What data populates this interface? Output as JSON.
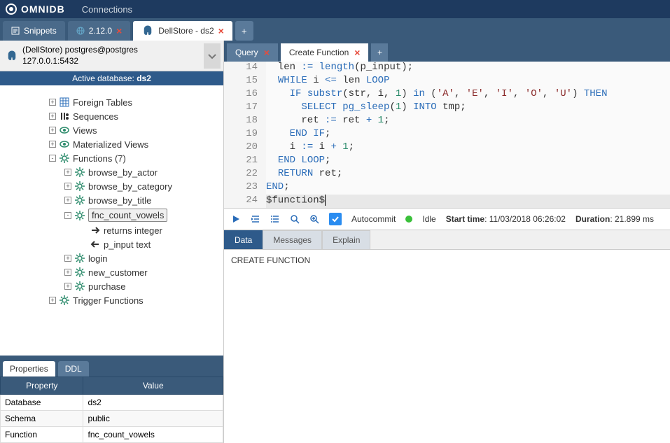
{
  "app": {
    "name": "OMNIDB",
    "connections_label": "Connections"
  },
  "tabs": [
    {
      "label": "Snippets",
      "closable": false
    },
    {
      "label": "2.12.0",
      "closable": true
    },
    {
      "label": "DellStore - ds2",
      "closable": true,
      "active": true
    }
  ],
  "connection": {
    "title": "(DellStore) postgres@postgres",
    "host": "127.0.0.1:5432",
    "active_db_prefix": "Active database: ",
    "active_db": "ds2"
  },
  "tree": {
    "nodes": [
      {
        "indent": 3,
        "toggle": "+",
        "icon": "table",
        "label": "Foreign Tables"
      },
      {
        "indent": 3,
        "toggle": "+",
        "icon": "seq",
        "label": "Sequences"
      },
      {
        "indent": 3,
        "toggle": "+",
        "icon": "view",
        "label": "Views"
      },
      {
        "indent": 3,
        "toggle": "+",
        "icon": "view",
        "label": "Materialized Views"
      },
      {
        "indent": 3,
        "toggle": "-",
        "icon": "gear",
        "label": "Functions (7)"
      },
      {
        "indent": 4,
        "toggle": "+",
        "icon": "gear",
        "label": "browse_by_actor"
      },
      {
        "indent": 4,
        "toggle": "+",
        "icon": "gear",
        "label": "browse_by_category"
      },
      {
        "indent": 4,
        "toggle": "+",
        "icon": "gear",
        "label": "browse_by_title"
      },
      {
        "indent": 4,
        "toggle": "-",
        "icon": "gear",
        "label": "fnc_count_vowels",
        "selected": true
      },
      {
        "indent": 5,
        "toggle": "",
        "icon": "arrow-right",
        "label": "returns integer"
      },
      {
        "indent": 5,
        "toggle": "",
        "icon": "arrow-left",
        "label": "p_input text"
      },
      {
        "indent": 4,
        "toggle": "+",
        "icon": "gear",
        "label": "login"
      },
      {
        "indent": 4,
        "toggle": "+",
        "icon": "gear",
        "label": "new_customer"
      },
      {
        "indent": 4,
        "toggle": "+",
        "icon": "gear",
        "label": "purchase"
      },
      {
        "indent": 3,
        "toggle": "+",
        "icon": "gear",
        "label": "Trigger Functions"
      }
    ]
  },
  "bottom_tabs": {
    "properties": "Properties",
    "ddl": "DDL"
  },
  "properties": {
    "header_property": "Property",
    "header_value": "Value",
    "rows": [
      {
        "k": "Database",
        "v": "ds2"
      },
      {
        "k": "Schema",
        "v": "public"
      },
      {
        "k": "Function",
        "v": "fnc_count_vowels"
      }
    ]
  },
  "inner_tabs": {
    "query": "Query",
    "create_function": "Create Function"
  },
  "code_lines": [
    {
      "n": 14,
      "html": "  len <span class='kw'>:=</span> <span class='func'>length</span>(p_input);"
    },
    {
      "n": 15,
      "html": "  <span class='kw'>WHILE</span> i <span class='kw'>&lt;=</span> len <span class='kw'>LOOP</span>"
    },
    {
      "n": 16,
      "html": "    <span class='kw'>IF</span> <span class='func'>substr</span>(str, i, <span class='num'>1</span>) <span class='kw'>in</span> (<span class='str'>'A'</span>, <span class='str'>'E'</span>, <span class='str'>'I'</span>, <span class='str'>'O'</span>, <span class='str'>'U'</span>) <span class='kw'>THEN</span>"
    },
    {
      "n": 17,
      "html": "      <span class='kw'>SELECT</span> <span class='func'>pg_sleep</span>(<span class='num'>1</span>) <span class='kw'>INTO</span> tmp;"
    },
    {
      "n": 18,
      "html": "      ret <span class='kw'>:=</span> ret <span class='kw'>+</span> <span class='num'>1</span>;"
    },
    {
      "n": 19,
      "html": "    <span class='kw'>END IF</span>;"
    },
    {
      "n": 20,
      "html": "    i <span class='kw'>:=</span> i <span class='kw'>+</span> <span class='num'>1</span>;"
    },
    {
      "n": 21,
      "html": "  <span class='kw'>END LOOP</span>;"
    },
    {
      "n": 22,
      "html": "  <span class='kw'>RETURN</span> ret;"
    },
    {
      "n": 23,
      "html": "<span class='kw'>END</span>;"
    },
    {
      "n": 24,
      "html": "$function$<span class='cursor'></span>",
      "current": true
    }
  ],
  "toolbar": {
    "autocommit": "Autocommit",
    "idle": "Idle",
    "start_time_label": "Start time",
    "start_time": "11/03/2018 06:26:02",
    "duration_label": "Duration",
    "duration": "21.899 ms"
  },
  "result_tabs": {
    "data": "Data",
    "messages": "Messages",
    "explain": "Explain"
  },
  "result_body": "CREATE FUNCTION"
}
